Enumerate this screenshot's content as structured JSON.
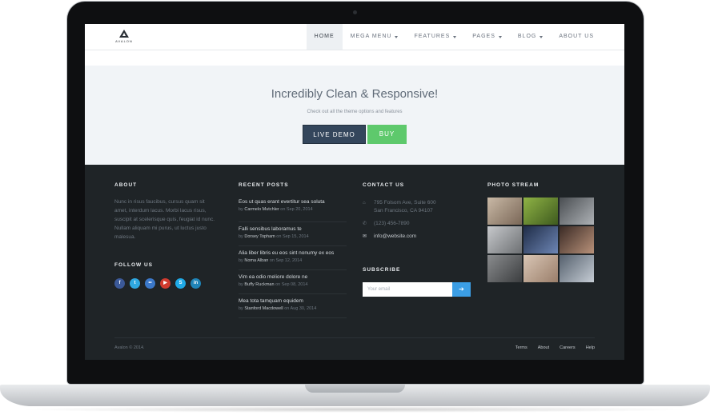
{
  "header": {
    "logo_text": "AVALON",
    "nav": [
      {
        "label": "HOME",
        "caret": false,
        "active": true
      },
      {
        "label": "MEGA MENU",
        "caret": true
      },
      {
        "label": "FEATURES",
        "caret": true
      },
      {
        "label": "PAGES",
        "caret": true
      },
      {
        "label": "BLOG",
        "caret": true
      },
      {
        "label": "ABOUT US",
        "caret": false
      }
    ]
  },
  "hero": {
    "title": "Incredibly Clean & Responsive!",
    "subtitle": "Check out all the theme options and features",
    "demo_label": "LIVE DEMO",
    "buy_label": "BUY"
  },
  "footer": {
    "about": {
      "title": "ABOUT",
      "text": "Nunc in risus faucibus, cursus quam sit amet, interdum lacus. Morbi lacus risus, suscipit at scelerisque quis, feugiat id nunc. Nullam aliquam mi purus, ut luctus justo malesua."
    },
    "follow": {
      "title": "FOLLOW US",
      "icons": [
        {
          "name": "facebook",
          "glyph": "f",
          "color": "#3b5998"
        },
        {
          "name": "twitter",
          "glyph": "t",
          "color": "#2fa8e1"
        },
        {
          "name": "flickr",
          "glyph": "••",
          "color": "#3b78c9"
        },
        {
          "name": "youtube",
          "glyph": "▶",
          "color": "#d03b2f"
        },
        {
          "name": "skype",
          "glyph": "S",
          "color": "#1fa9e6"
        },
        {
          "name": "linkedin",
          "glyph": "in",
          "color": "#1f84b8"
        }
      ]
    },
    "recent_posts": {
      "title": "RECENT POSTS",
      "items": [
        {
          "title": "Eos ut quas erant evertitur sea soluta",
          "by": "by",
          "author": "Carmelo Mutchler",
          "on": "on Sep 20, 2014"
        },
        {
          "title": "Falli sensibus laboramus te",
          "by": "by",
          "author": "Dorsey Topham",
          "on": "on Sep 15, 2014"
        },
        {
          "title": "Alia liber libris eu eos sint nonumy ex eos",
          "by": "by",
          "author": "Noma Alban",
          "on": "on Sep 12, 2014"
        },
        {
          "title": "Vim ea odio meliore dolore ne",
          "by": "by",
          "author": "Buffy Ruckman",
          "on": "on Sep 08, 2014"
        },
        {
          "title": "Mea tota tamquam equidem",
          "by": "by",
          "author": "Stanford Macdowell",
          "on": "on Aug 30, 2014"
        }
      ]
    },
    "contact": {
      "title": "CONTACT US",
      "address_line1": "795 Folsom Ave, Suite 600",
      "address_line2": "San Francisco, CA 94107",
      "phone": "(123) 456-7890",
      "email": "info@website.com"
    },
    "subscribe": {
      "title": "SUBSCRIBE",
      "placeholder": "Your email",
      "button_glyph": "➔"
    },
    "photo_stream": {
      "title": "PHOTO STREAM",
      "photos": [
        {
          "colors": [
            "#c9b9a6",
            "#7a6757"
          ]
        },
        {
          "colors": [
            "#8fb345",
            "#3e5a1e"
          ]
        },
        {
          "colors": [
            "#4a4e52",
            "#aeb2b6"
          ]
        },
        {
          "colors": [
            "#c7c9cc",
            "#6d7073"
          ]
        },
        {
          "colors": [
            "#1f2c47",
            "#6d86b5"
          ]
        },
        {
          "colors": [
            "#3a2a25",
            "#b9927a"
          ]
        },
        {
          "colors": [
            "#8a8c8e",
            "#3c3e40"
          ]
        },
        {
          "colors": [
            "#d9c6b5",
            "#9a7e6a"
          ]
        },
        {
          "colors": [
            "#55606d",
            "#c6cdd5"
          ]
        }
      ]
    },
    "copyright": "Avalon © 2014.",
    "links": [
      "Terms",
      "About",
      "Careers",
      "Help"
    ]
  }
}
